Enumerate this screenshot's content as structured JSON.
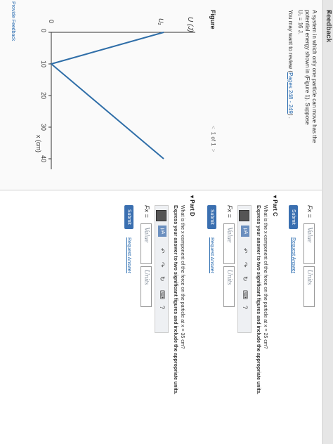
{
  "header": {
    "title": "Feedback"
  },
  "left": {
    "problem_line1": "A system in which only one particle can move has the",
    "problem_line2": "potential energy shown in (Figure 1). Suppose",
    "problem_line3": "U₁ = 16 J.",
    "review_prefix": "You may want to review (",
    "review_link": "Pages 248 - 249",
    "review_suffix": ") .",
    "figure_label": "Figure",
    "pager": "1 of 1",
    "feedback": "Provide Feedback"
  },
  "graph": {
    "ylabel": "U (J)",
    "u1_label": "U₁",
    "xlabel": "x (cm)",
    "x_ticks": [
      "0",
      "10",
      "20",
      "30",
      "40"
    ],
    "y_zero": "0"
  },
  "chart_data": {
    "type": "line",
    "x": [
      0,
      10,
      40
    ],
    "y": [
      16,
      0,
      16
    ],
    "xlabel": "x (cm)",
    "ylabel": "U (J)",
    "xlim": [
      0,
      45
    ]
  },
  "top_answer": {
    "label": "Fx =",
    "value_placeholder": "Value",
    "units_placeholder": "Units",
    "submit": "Submit",
    "request": "Request Answer"
  },
  "partC": {
    "title": "Part C",
    "question": "What is the x-component of the force on the particle at x = 25 cm?",
    "instruction": "Express your answer to two significant figures and include the appropriate units.",
    "label": "Fx =",
    "value_placeholder": "Value",
    "units_placeholder": "Units",
    "submit": "Submit",
    "request": "Request Answer"
  },
  "partD": {
    "title": "Part D",
    "question": "What is the x-component of the force on the particle at x = 35 cm?",
    "instruction": "Express your answer to two significant figures and include the appropriate units.",
    "label": "Fx =",
    "value_placeholder": "Value",
    "units_placeholder": "Units",
    "submit": "Submit",
    "request": "Request Answer"
  },
  "toolbar": {
    "mu": "μA",
    "help": "?"
  }
}
